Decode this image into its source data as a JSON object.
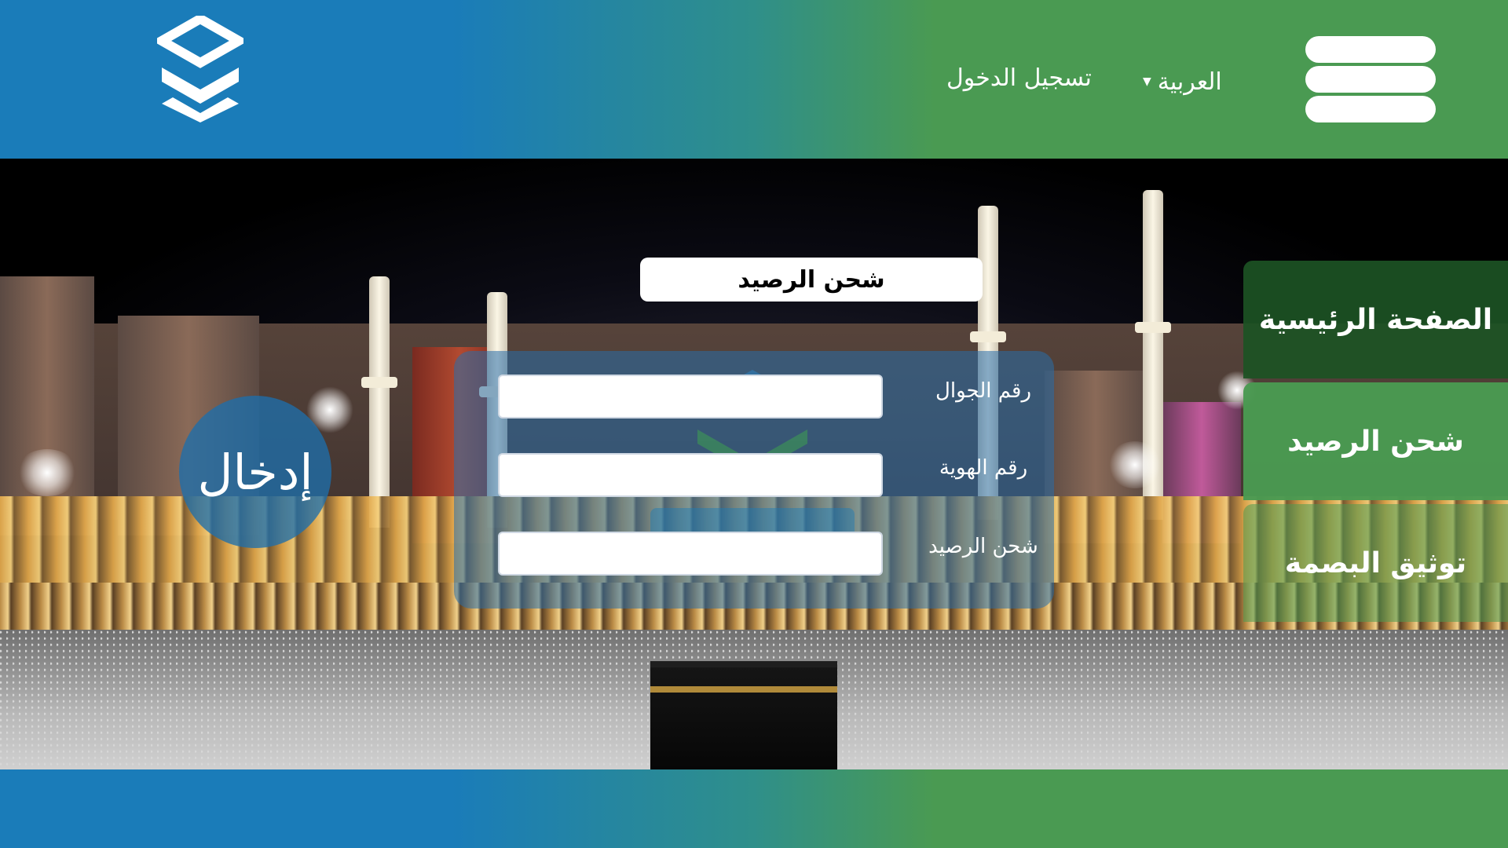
{
  "header": {
    "language_label": "العربية",
    "login_label": "تسجيل الدخول"
  },
  "sidenav": {
    "items": [
      {
        "label": "الصفحة الرئيسية"
      },
      {
        "label": "شحن الرصيد"
      },
      {
        "label": "توثيق البصمة"
      }
    ]
  },
  "form": {
    "title": "شحن الرصيد",
    "fields": [
      {
        "label": "رقم الجوال",
        "value": ""
      },
      {
        "label": "رقم الهوية",
        "value": ""
      },
      {
        "label": "شحن الرصيد",
        "value": ""
      }
    ],
    "submit_label": "إدخال"
  },
  "colors": {
    "brand_blue": "#1a7cb9",
    "brand_green": "#4a9a52",
    "nav_dark_green": "#1c5224"
  },
  "icons": {
    "logo": "stacked-chevrons-logo",
    "menu": "hamburger-menu-icon",
    "caret": "caret-down-icon"
  }
}
